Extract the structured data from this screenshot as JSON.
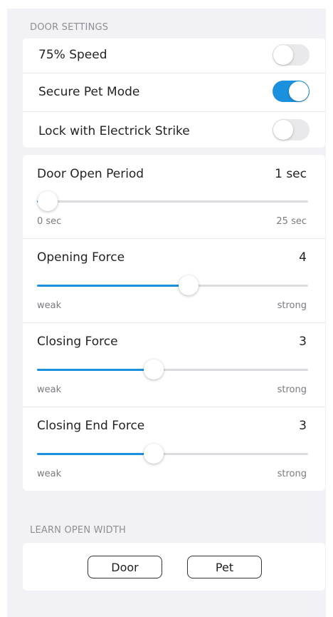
{
  "colors": {
    "accent": "#1b90dd",
    "background": "#f2f2f6",
    "card": "#ffffff"
  },
  "door_settings": {
    "header": "DOOR SETTINGS",
    "toggles": [
      {
        "label": "75% Speed",
        "on": false
      },
      {
        "label": "Secure Pet Mode",
        "on": true
      },
      {
        "label": "Lock with Electrick Strike",
        "on": false
      }
    ]
  },
  "sliders": [
    {
      "label": "Door Open Period",
      "value": "1 sec",
      "min_label": "0 sec",
      "max_label": "25 sec",
      "fraction": 0.04
    },
    {
      "label": "Opening Force",
      "value": "4",
      "min_label": "weak",
      "max_label": "strong",
      "fraction": 0.56
    },
    {
      "label": "Closing Force",
      "value": "3",
      "min_label": "weak",
      "max_label": "strong",
      "fraction": 0.43
    },
    {
      "label": "Closing End Force",
      "value": "3",
      "min_label": "weak",
      "max_label": "strong",
      "fraction": 0.43
    }
  ],
  "learn_open_width": {
    "header": "LEARN OPEN WIDTH",
    "door_button": "Door",
    "pet_button": "Pet"
  }
}
